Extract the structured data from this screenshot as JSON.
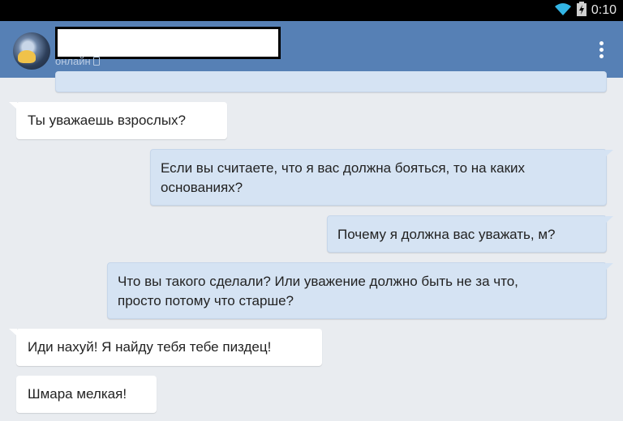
{
  "status_bar": {
    "time": "0:10"
  },
  "header": {
    "presence": "онлайн"
  },
  "messages": [
    {
      "direction": "in",
      "text": "Ты уважаешь взрослых?"
    },
    {
      "direction": "out",
      "text": "Если вы считаете, что я вас должна бояться, то на каких\nоснованиях?"
    },
    {
      "direction": "out",
      "text": "Почему я должна вас уважать, м?"
    },
    {
      "direction": "out",
      "text": "Что вы такого сделали? Или уважение должно быть не за что,\nпросто потому что старше?"
    },
    {
      "direction": "in",
      "text": "Иди нахуй! Я найду тебя тебе пиздец!"
    },
    {
      "direction": "in",
      "text": "Шмара мелкая!"
    }
  ],
  "colors": {
    "app_bar": "#5680b5",
    "chat_background": "#e9ecf0",
    "outgoing_bubble": "#d5e3f3",
    "incoming_bubble": "#ffffff"
  }
}
